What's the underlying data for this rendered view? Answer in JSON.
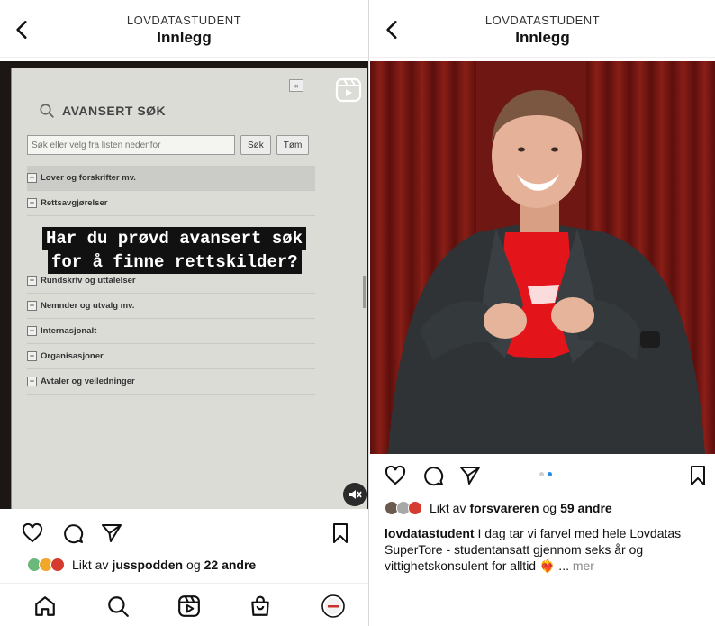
{
  "left_post": {
    "header": {
      "username": "LOVDATASTUDENT",
      "title": "Innlegg"
    },
    "video": {
      "advanced_search_label": "AVANSERT SØK",
      "search_placeholder": "Søk eller velg fra listen nedenfor",
      "search_button": "Søk",
      "clear_button": "Tøm",
      "collapse_label": "«",
      "categories_top": [
        "Lover og forskrifter mv.",
        "Rettsavgjørelser"
      ],
      "categories_bottom": [
        "Rundskriv og uttalelser",
        "Nemnder og utvalg mv.",
        "Internasjonalt",
        "Organisasjoner",
        "Avtaler og veiledninger"
      ],
      "overlay_line1": "Har du prøvd avansert søk",
      "overlay_line2": "for å finne rettskilder?"
    },
    "likes": {
      "prefix": "Likt av",
      "user": "jusspodden",
      "middle": "og",
      "count": "22 andre"
    }
  },
  "right_post": {
    "header": {
      "username": "LOVDATASTUDENT",
      "title": "Innlegg"
    },
    "carousel": {
      "current": 2,
      "total": 2
    },
    "likes": {
      "prefix": "Likt av",
      "user": "forsvareren",
      "middle": "og",
      "count": "59 andre"
    },
    "caption": {
      "username": "lovdatastudent",
      "text": "I dag tar vi farvel med hele Lovdatas SuperTore - studentansatt gjennom seks år og vittighetskonsulent for alltid ❤️‍🔥 ...",
      "more": "mer"
    }
  },
  "colors": {
    "accent": "#2a8ae8",
    "text": "#111111",
    "muted": "#888888"
  },
  "icons": [
    "back-icon",
    "heart-icon",
    "comment-icon",
    "send-icon",
    "bookmark-icon",
    "home-icon",
    "search-icon",
    "reels-icon",
    "shop-icon",
    "profile-icon",
    "mute-icon"
  ]
}
